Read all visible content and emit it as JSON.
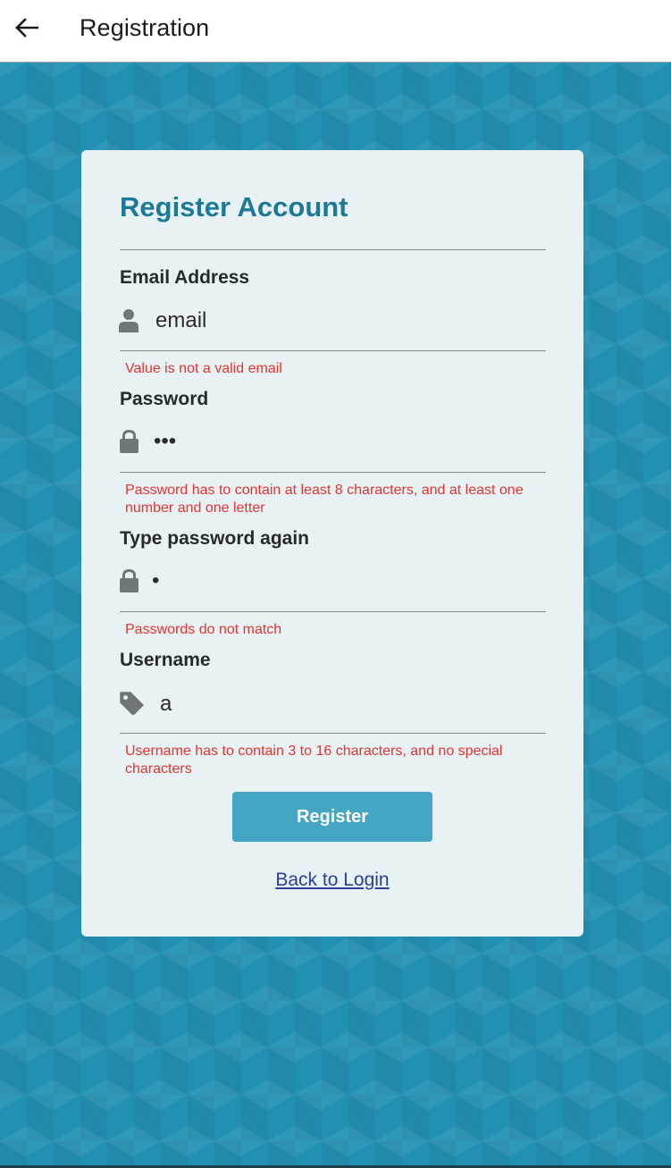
{
  "appbar": {
    "title": "Registration",
    "back_icon": "arrow-left-icon"
  },
  "colors": {
    "background": "#2290b2",
    "card": "#e8f2f5",
    "title": "#1c7a96",
    "error": "#e8322d",
    "button": "#45a6c3",
    "link": "#2c3e99"
  },
  "card": {
    "title": "Register Account",
    "email": {
      "label": "Email Address",
      "icon": "user-icon",
      "value": "email",
      "error": "Value is not a valid email"
    },
    "password": {
      "label": "Password",
      "icon": "lock-icon",
      "value": "•••",
      "error": "Password has to contain at least 8 characters, and at least one number and one letter"
    },
    "password_again": {
      "label": "Type password again",
      "icon": "lock-icon",
      "value": "•",
      "error": "Passwords do not match"
    },
    "username": {
      "label": "Username",
      "icon": "tag-icon",
      "value": "a",
      "error": "Username has to contain 3 to 16 characters, and no special characters"
    },
    "register_label": "Register",
    "back_to_login_label": "Back to Login"
  }
}
